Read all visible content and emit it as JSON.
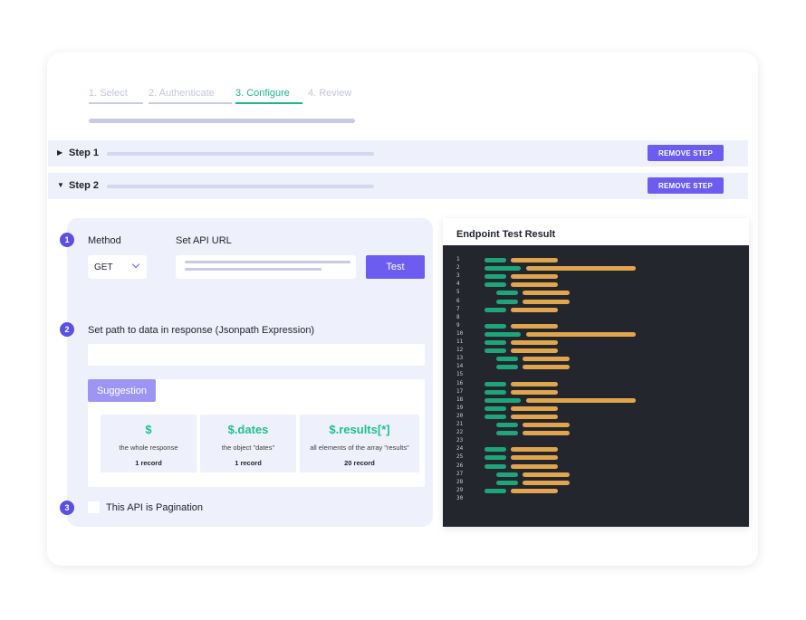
{
  "wizard": {
    "tabs": [
      {
        "label": "1. Select",
        "state": "done"
      },
      {
        "label": "2. Authenticate",
        "state": "done"
      },
      {
        "label": "3. Configure",
        "state": "active"
      },
      {
        "label": "4. Review",
        "state": "pending"
      }
    ]
  },
  "steps": [
    {
      "title": "Step 1",
      "expanded": false,
      "remove_label": "REMOVE STEP"
    },
    {
      "title": "Step 2",
      "expanded": true,
      "remove_label": "REMOVE STEP"
    }
  ],
  "config": {
    "section1_number": "1",
    "method_label": "Method",
    "api_url_label": "Set API URL",
    "method_value": "GET",
    "test_label": "Test",
    "section2_number": "2",
    "path_label": "Set path to data in response (Jsonpath Expression)",
    "suggestion_label": "Suggestion",
    "suggestions": [
      {
        "expr": "$",
        "desc": "the whole response",
        "count": "1 record"
      },
      {
        "expr": "$.dates",
        "desc": "the object \"dates\"",
        "count": "1 record"
      },
      {
        "expr": "$.results[*]",
        "desc": "all elements of the array \"results\"",
        "count": "20 record"
      }
    ],
    "section3_number": "3",
    "pagination_label": "This API is Pagination"
  },
  "endpoint": {
    "title": "Endpoint Test Result",
    "line_numbers": [
      "1",
      "2",
      "3",
      "4",
      "5",
      "6",
      "7",
      "8",
      "9",
      "10",
      "11",
      "12",
      "13",
      "14",
      "15",
      "16",
      "17",
      "18",
      "19",
      "20",
      "21",
      "22",
      "23",
      "24",
      "25",
      "26",
      "27",
      "28",
      "29",
      "30"
    ]
  },
  "colors": {
    "accent": "#6c5cf0",
    "active_tab": "#1fb58c",
    "code_key": "#1fa57b",
    "code_value": "#e0a54d",
    "code_bg": "#24262d"
  }
}
